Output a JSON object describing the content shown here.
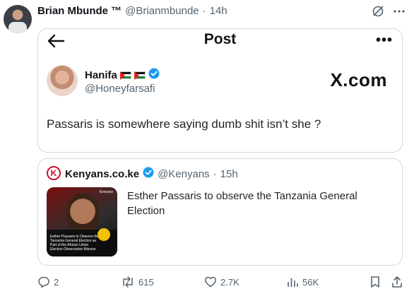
{
  "tweet": {
    "author_name": "Brian Mbunde ™",
    "author_handle": "@Brianmbunde",
    "separator": "·",
    "timestamp": "14h"
  },
  "embedded_post": {
    "header_title": "Post",
    "more_label": "•••",
    "author_name": "Hanifa",
    "author_handle": "@Honeyfarsafi",
    "brand": "X.com",
    "text": "Passaris is somewhere saying dumb shit isn’t she ?"
  },
  "quote": {
    "logo_letter": "K",
    "author_name": "Kenyans.co.ke",
    "author_handle": "@Kenyans",
    "separator": "·",
    "timestamp": "15h",
    "text": "Esther Passaris to observe the Tanzania General Election",
    "thumbnail_caption": "Esther Passaris to Observe the Tanzania General Election as Part of the African Union Election Observation Mission",
    "thumbnail_tag": "Kenyans"
  },
  "actions": {
    "replies": "2",
    "reposts": "615",
    "likes": "2.7K",
    "views": "56K"
  },
  "colors": {
    "muted": "#536471",
    "verified": "#1d9bf0",
    "kenyans_red": "#c8102e",
    "border": "#cfd9de"
  },
  "icons": [
    "back-arrow-icon",
    "grok-icon",
    "more-icon",
    "verified-badge-icon",
    "reply-icon",
    "repost-icon",
    "like-icon",
    "views-icon",
    "bookmark-icon",
    "share-icon"
  ]
}
